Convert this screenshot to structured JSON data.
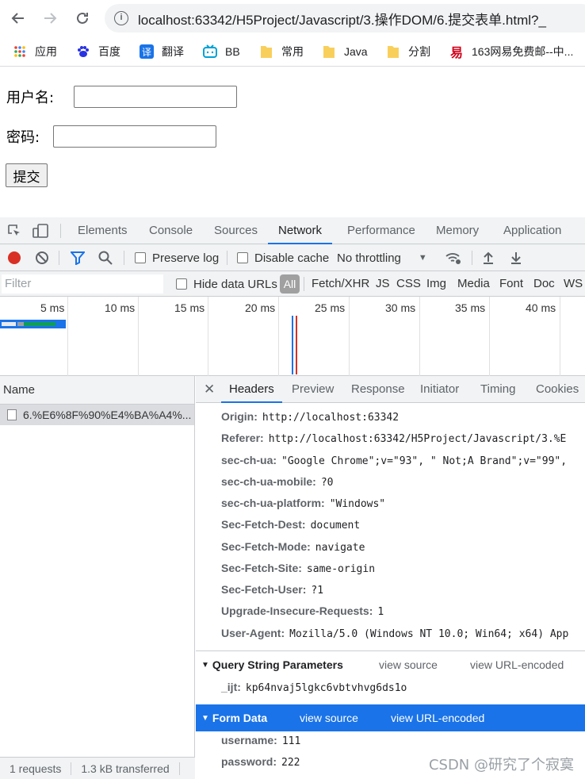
{
  "browser": {
    "url": "localhost:63342/H5Project/Javascript/3.操作DOM/6.提交表单.html?_",
    "bookmarks": [
      {
        "label": "应用",
        "icon": "apps-grid-icon"
      },
      {
        "label": "百度",
        "icon": "baidu-paw-icon"
      },
      {
        "label": "翻译",
        "icon": "translate-icon"
      },
      {
        "label": "BB",
        "icon": "bilibili-icon"
      },
      {
        "label": "常用",
        "icon": "folder-icon"
      },
      {
        "label": "Java",
        "icon": "folder-icon"
      },
      {
        "label": "分割",
        "icon": "folder-icon"
      },
      {
        "label": "163网易免费邮--中...",
        "icon": "netease-mail-icon"
      }
    ]
  },
  "form": {
    "username_label": "用户名:",
    "password_label": "密码:",
    "submit_label": "提交"
  },
  "devtools": {
    "tabs": [
      "Elements",
      "Console",
      "Sources",
      "Network",
      "Performance",
      "Memory",
      "Application"
    ],
    "active_tab": "Network",
    "toolbar": {
      "preserve_log": "Preserve log",
      "disable_cache": "Disable cache",
      "throttling": "No throttling"
    },
    "filter": {
      "placeholder": "Filter",
      "hide_data_urls": "Hide data URLs",
      "all": "All",
      "types": [
        "Fetch/XHR",
        "JS",
        "CSS",
        "Img",
        "Media",
        "Font",
        "Doc",
        "WS"
      ]
    },
    "timeline_ticks": [
      "5 ms",
      "10 ms",
      "15 ms",
      "20 ms",
      "25 ms",
      "30 ms",
      "35 ms",
      "40 ms"
    ],
    "requests": {
      "name_header": "Name",
      "rows": [
        "6.%E6%8F%90%E4%BA%A4%..."
      ]
    },
    "status": {
      "requests": "1 requests",
      "transferred": "1.3 kB transferred"
    },
    "detail_tabs": [
      "Headers",
      "Preview",
      "Response",
      "Initiator",
      "Timing",
      "Cookies"
    ],
    "request_headers": [
      {
        "key": "Origin:",
        "value": "http://localhost:63342"
      },
      {
        "key": "Referer:",
        "value": "http://localhost:63342/H5Project/Javascript/3.%E"
      },
      {
        "key": "sec-ch-ua:",
        "value": "\"Google Chrome\";v=\"93\", \" Not;A Brand\";v=\"99\","
      },
      {
        "key": "sec-ch-ua-mobile:",
        "value": "?0"
      },
      {
        "key": "sec-ch-ua-platform:",
        "value": "\"Windows\""
      },
      {
        "key": "Sec-Fetch-Dest:",
        "value": "document"
      },
      {
        "key": "Sec-Fetch-Mode:",
        "value": "navigate"
      },
      {
        "key": "Sec-Fetch-Site:",
        "value": "same-origin"
      },
      {
        "key": "Sec-Fetch-User:",
        "value": "?1"
      },
      {
        "key": "Upgrade-Insecure-Requests:",
        "value": "1"
      },
      {
        "key": "User-Agent:",
        "value": "Mozilla/5.0 (Windows NT 10.0; Win64; x64) App"
      }
    ],
    "query_string": {
      "title": "Query String Parameters",
      "view_source": "view source",
      "view_url_encoded": "view URL-encoded",
      "params": [
        {
          "key": "_ijt:",
          "value": "kp64nvaj5lgkc6vbtvhvg6ds1o"
        }
      ]
    },
    "form_data": {
      "title": "Form Data",
      "view_source": "view source",
      "view_url_encoded": "view URL-encoded",
      "params": [
        {
          "key": "username:",
          "value": "111"
        },
        {
          "key": "password:",
          "value": "222"
        }
      ]
    }
  },
  "watermark": "CSDN @研究了个寂寞",
  "colors": {
    "accent": "#1a73e8",
    "record_red": "#d93025",
    "waterfall_blue": "#1a73e8",
    "waterfall_green": "#0f9d58"
  }
}
